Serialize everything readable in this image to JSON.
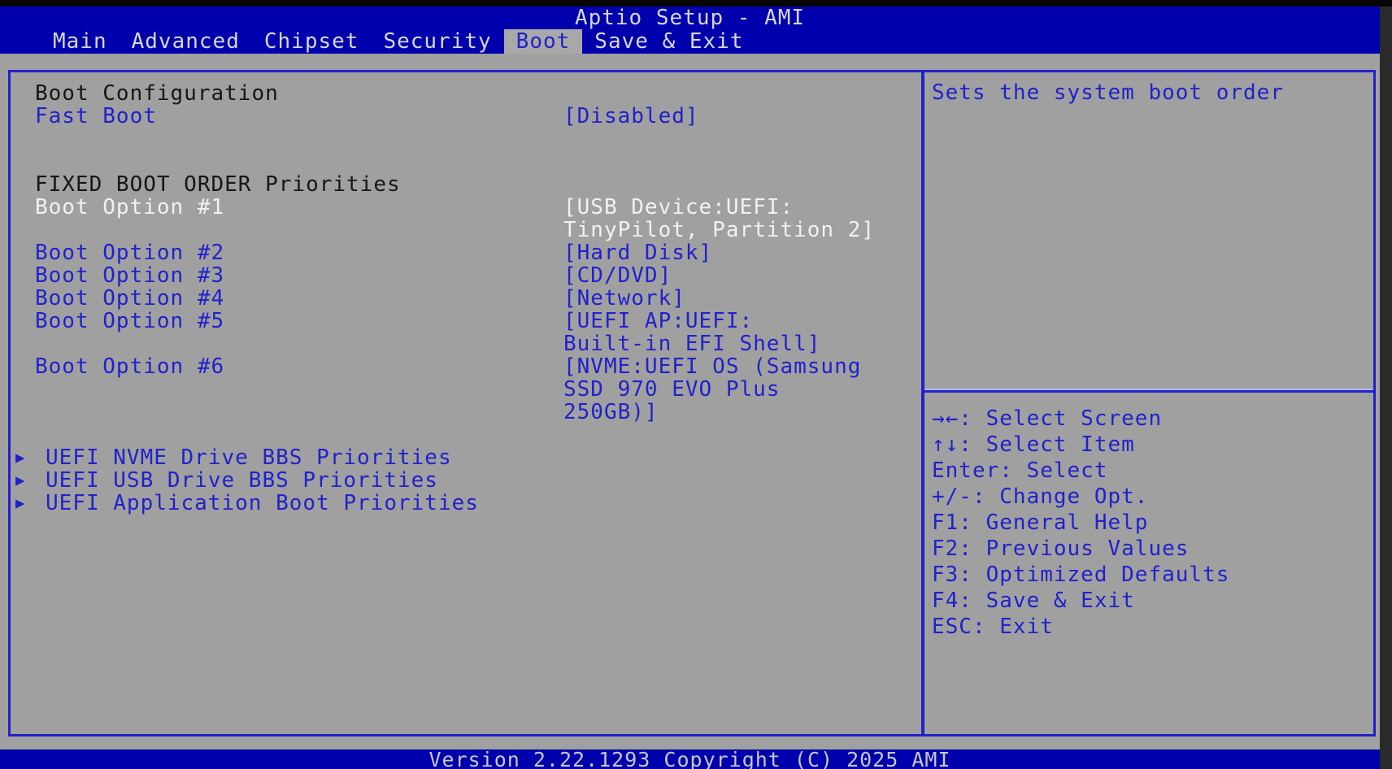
{
  "window": {
    "title": "Aptio Setup - AMI",
    "version_bar": "Version 2.22.1293 Copyright (C) 2025 AMI"
  },
  "colors": {
    "header_blue": "#0000ac",
    "accent_blue": "#2121cc",
    "background_gray": "#a0a0a0",
    "selected_item_text": "#f1f1f1",
    "heading_text": "#161616"
  },
  "icons": {
    "submenu_arrow": "▶"
  },
  "menu": {
    "tabs": [
      {
        "label": "Main",
        "selected": false
      },
      {
        "label": "Advanced",
        "selected": false
      },
      {
        "label": "Chipset",
        "selected": false
      },
      {
        "label": "Security",
        "selected": false
      },
      {
        "label": "Boot",
        "selected": true
      },
      {
        "label": "Save & Exit",
        "selected": false
      }
    ]
  },
  "main": {
    "rows": [
      {
        "type": "heading",
        "label": "Boot Configuration"
      },
      {
        "type": "option",
        "label": "Fast Boot",
        "value": "[Disabled]",
        "state": "normal"
      },
      {
        "type": "blank"
      },
      {
        "type": "blank"
      },
      {
        "type": "heading",
        "label": "FIXED BOOT ORDER Priorities"
      },
      {
        "type": "option",
        "label": "Boot Option #1",
        "value": "[USB Device:UEFI:\nTinyPilot, Partition 2]",
        "state": "selected"
      },
      {
        "type": "option",
        "label": "Boot Option #2",
        "value": "[Hard Disk]",
        "state": "normal"
      },
      {
        "type": "option",
        "label": "Boot Option #3",
        "value": "[CD/DVD]",
        "state": "normal"
      },
      {
        "type": "option",
        "label": "Boot Option #4",
        "value": "[Network]",
        "state": "normal"
      },
      {
        "type": "option",
        "label": "Boot Option #5",
        "value": "[UEFI AP:UEFI:\nBuilt-in EFI Shell]",
        "state": "normal"
      },
      {
        "type": "option",
        "label": "Boot Option #6",
        "value": "[NVME:UEFI OS (Samsung\nSSD 970 EVO Plus\n250GB)]",
        "state": "normal"
      },
      {
        "type": "blank"
      },
      {
        "type": "submenu",
        "label": "UEFI NVME Drive BBS Priorities"
      },
      {
        "type": "submenu",
        "label": "UEFI USB Drive BBS Priorities"
      },
      {
        "type": "submenu",
        "label": "UEFI Application Boot Priorities"
      }
    ]
  },
  "help": {
    "text": "Sets the system boot order"
  },
  "legend": {
    "items": [
      "→←: Select Screen",
      "↑↓: Select Item",
      "Enter: Select",
      "+/-: Change Opt.",
      "F1: General Help",
      "F2: Previous Values",
      "F3: Optimized Defaults",
      "F4: Save & Exit",
      "ESC: Exit"
    ]
  }
}
